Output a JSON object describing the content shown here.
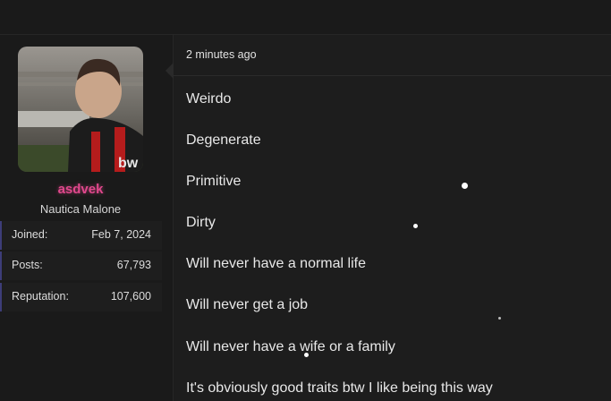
{
  "author": {
    "username": "asdvek",
    "title": "Nautica Malone",
    "stats": [
      {
        "label": "Joined:",
        "value": "Feb 7, 2024"
      },
      {
        "label": "Posts:",
        "value": "67,793"
      },
      {
        "label": "Reputation:",
        "value": "107,600"
      }
    ]
  },
  "post": {
    "time": "2 minutes ago",
    "lines": [
      "Weirdo",
      "Degenerate",
      "Primitive",
      "Dirty",
      "Will never have a normal life",
      "Will never get a job",
      "Will never have a wife or a family",
      "It's obviously good traits btw I like being this way"
    ]
  },
  "colors": {
    "username": "#e0488c",
    "background": "#1d1d1d",
    "sidebar": "#1a1a1a"
  }
}
